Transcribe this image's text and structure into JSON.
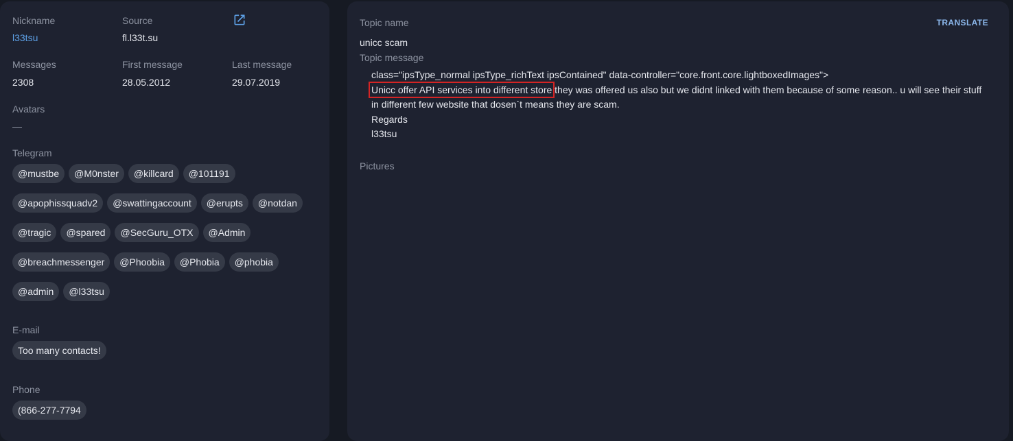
{
  "profile": {
    "nickname_label": "Nickname",
    "nickname": "l33tsu",
    "source_label": "Source",
    "source": "fl.l33t.su",
    "messages_label": "Messages",
    "messages": "2308",
    "first_message_label": "First message",
    "first_message": "28.05.2012",
    "last_message_label": "Last message",
    "last_message": "29.07.2019",
    "avatars_label": "Avatars",
    "avatars": "—",
    "telegram_label": "Telegram",
    "telegram": [
      "@mustbe",
      "@M0nster",
      "@killcard",
      "@101191",
      "@apophissquadv2",
      "@swattingaccount",
      "@erupts",
      "@notdan",
      "@tragic",
      "@spared",
      "@SecGuru_OTX",
      "@Admin",
      "@breachmessenger",
      "@Phoobia",
      "@Phobia",
      "@phobia",
      "@admin",
      "@l33tsu"
    ],
    "email_label": "E-mail",
    "email": "Too many contacts!",
    "phone_label": "Phone",
    "phone": "(866-277-7794"
  },
  "topic": {
    "name_label": "Topic name",
    "name": "unicc scam",
    "translate_label": "TRANSLATE",
    "message_label": "Topic message",
    "line1": "class=\"ipsType_normal ipsType_richText ipsContained\" data-controller=\"core.front.core.lightboxedImages\">",
    "line2_highlight": "Unicc offer API services into different store",
    "line2_rest": " they was offered us also but we didnt linked with them because of some reason.. u will see their stuff in different few website that dosen`t means they are scam.",
    "line3": "Regards",
    "line4": "l33tsu",
    "pictures_label": "Pictures"
  },
  "icons": {
    "source_link": "external-link-icon"
  },
  "colors": {
    "background": "#161a23",
    "panel": "#1e2230",
    "chip": "#353a47",
    "link": "#5ea2e8",
    "label": "#8d93a1",
    "highlight_border": "#d42424"
  }
}
